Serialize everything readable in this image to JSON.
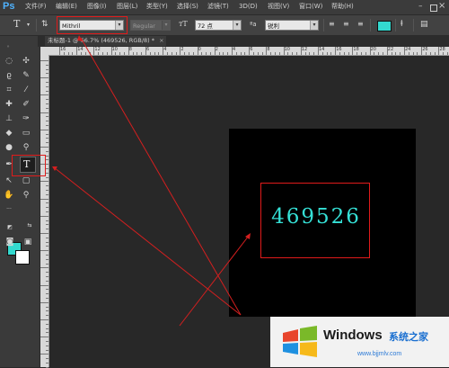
{
  "app": {
    "logo": "Ps",
    "menus": [
      "文件(F)",
      "编辑(E)",
      "图像(I)",
      "图层(L)",
      "类型(Y)",
      "选择(S)",
      "滤镜(T)",
      "3D(D)",
      "视图(V)",
      "窗口(W)",
      "帮助(H)"
    ]
  },
  "options_bar": {
    "tool_glyph": "T",
    "font_family": "Mithril",
    "font_style": "Regular",
    "font_size": "72 点",
    "aa_glyph": "ªa",
    "antialias": "锐利",
    "text_color": "#33d9cf"
  },
  "document": {
    "tab_label": "未标题-1 @ 66.7% (469526, RGB/8) *",
    "tab_close": "×",
    "ruler_labels": [
      "16",
      "14",
      "12",
      "10",
      "8",
      "6",
      "4",
      "2",
      "0",
      "2",
      "4",
      "6",
      "8",
      "10",
      "12",
      "14",
      "16",
      "18",
      "20",
      "22",
      "24",
      "26",
      "28"
    ],
    "canvas_text": "469526"
  },
  "colors": {
    "foreground": "#33d9cf",
    "background": "#ffffff",
    "annotation": "#e01b1b"
  },
  "watermark": {
    "brand": "Windows",
    "tagline": "系统之家",
    "url": "www.bjjmlv.com"
  }
}
